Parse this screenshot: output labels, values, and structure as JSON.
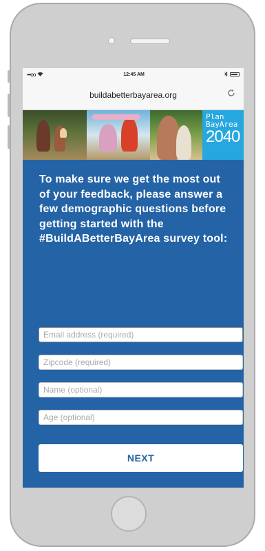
{
  "status_bar": {
    "signal": "•••oo",
    "wifi_icon": "wifi-icon",
    "time": "12:45 AM",
    "bluetooth_icon": "bluetooth-icon",
    "battery_icon": "battery-icon"
  },
  "browser": {
    "url": "buildabetterbayarea.org",
    "reload_icon": "reload-icon"
  },
  "banner": {
    "logo_line1": "Plan",
    "logo_line2": "BayArea",
    "logo_year": "2040"
  },
  "intro_text": "To make sure we get the most out of your feedback, please answer a few demographic questions before getting started with the #BuildABetterBayArea survey tool:",
  "form": {
    "email_placeholder": "Email address (required)",
    "zipcode_placeholder": "Zipcode (required)",
    "name_placeholder": "Name (optional)",
    "age_placeholder": "Age (optional)",
    "next_label": "NEXT"
  },
  "colors": {
    "screen_bg": "#2463a6",
    "logo_bg": "#27a7df",
    "button_text": "#2463a6"
  }
}
